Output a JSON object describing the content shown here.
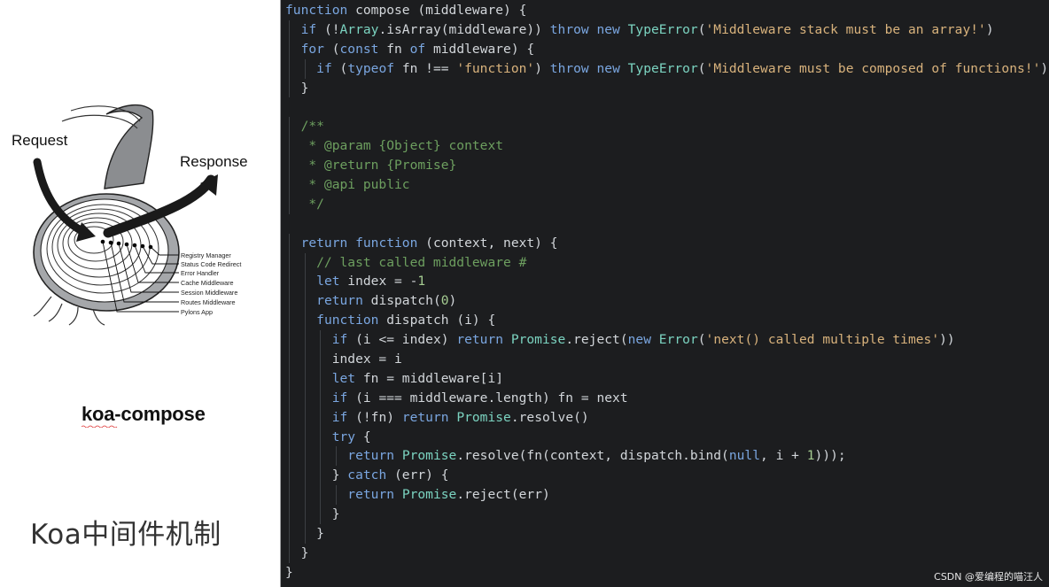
{
  "diagram": {
    "request_label": "Request",
    "response_label": "Response",
    "layers": [
      "Registry Manager",
      "Status Code Redirect",
      "Error Handler",
      "Cache Middleware",
      "Session Middleware",
      "Routes Middleware",
      "Pylons App"
    ]
  },
  "caption": "koa-compose",
  "slide_title": "Koa中间件机制",
  "code_lines": [
    "function compose (middleware) {",
    "  if (!Array.isArray(middleware)) throw new TypeError('Middleware stack must be an array!')",
    "  for (const fn of middleware) {",
    "    if (typeof fn !== 'function') throw new TypeError('Middleware must be composed of functions!')",
    "  }",
    "",
    "  /**",
    "   * @param {Object} context",
    "   * @return {Promise}",
    "   * @api public",
    "   */",
    "",
    "  return function (context, next) {",
    "    // last called middleware #",
    "    let index = -1",
    "    return dispatch(0)",
    "    function dispatch (i) {",
    "      if (i <= index) return Promise.reject(new Error('next() called multiple times'))",
    "      index = i",
    "      let fn = middleware[i]",
    "      if (i === middleware.length) fn = next",
    "      if (!fn) return Promise.resolve()",
    "      try {",
    "        return Promise.resolve(fn(context, dispatch.bind(null, i + 1)));",
    "      } catch (err) {",
    "        return Promise.reject(err)",
    "      }",
    "    }",
    "  }",
    "}"
  ],
  "watermark": "CSDN @爱编程的喵汪人",
  "colors": {
    "code_background": "#1c1d1f",
    "keyword": "#7aa6e0",
    "function_name": "#7bd3c0",
    "string": "#d8b27c",
    "comment": "#6d9f5f",
    "number": "#a6cd92"
  }
}
